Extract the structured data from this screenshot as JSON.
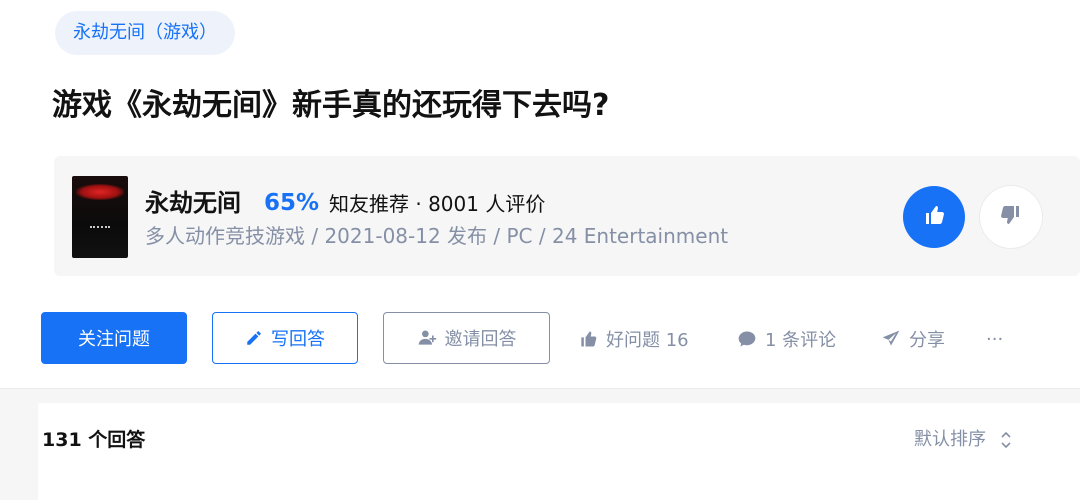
{
  "topic_tag": "永劫无间（游戏）",
  "question_title": "游戏《永劫无间》新手真的还玩得下去吗?",
  "game_card": {
    "name": "永劫无间",
    "score": "65%",
    "rating_text": "知友推荐 · 8001 人评价",
    "meta": "多人动作竞技游戏 / 2021-08-12 发布 / PC / 24 Entertainment",
    "cover_icon": "game-cover-image",
    "upvote_icon": "thumbs-up-icon",
    "downvote_icon": "thumbs-down-icon"
  },
  "actions": {
    "follow": "关注问题",
    "write_answer": "写回答",
    "invite_answer": "邀请回答",
    "good_question": "好问题 16",
    "comments": "1 条评论",
    "share": "分享",
    "more": "···"
  },
  "answers": {
    "count": "131 个回答",
    "sort": "默认排序"
  },
  "colors": {
    "accent": "#1772f6",
    "muted": "#8590a6",
    "tag_bg": "#eef3fb",
    "page_bg": "#f6f6f6"
  }
}
